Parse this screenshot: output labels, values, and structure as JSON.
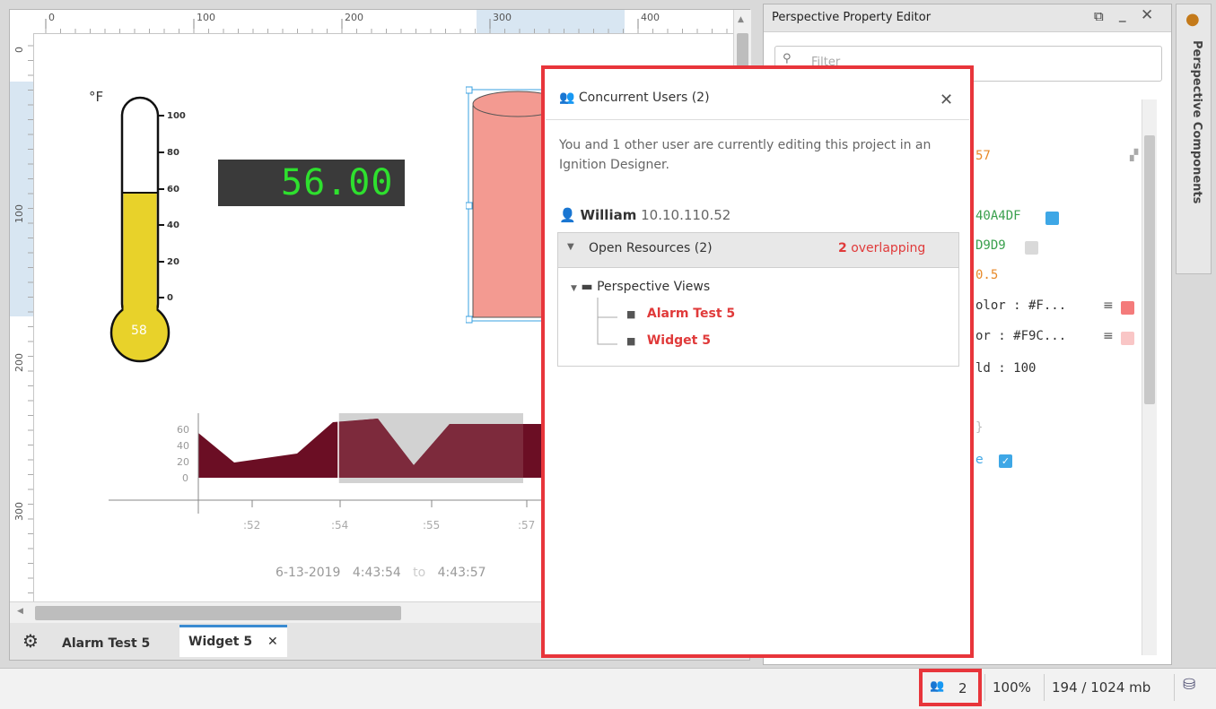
{
  "canvas": {
    "ruler_top_labels": [
      "0",
      "100",
      "200",
      "300",
      "400"
    ],
    "ruler_left_labels": [
      "0",
      "100",
      "200",
      "300"
    ],
    "thermometer": {
      "unit": "°F",
      "scale": [
        "100",
        "80",
        "60",
        "40",
        "20",
        "0"
      ],
      "value": "58",
      "fill_fraction": 0.58,
      "fill_color": "#e8d22a"
    },
    "led_display": {
      "value": "56.00",
      "color": "#2ee02e"
    },
    "tank": {
      "color": "#f39a91"
    },
    "sparkline": {
      "y_ticks": [
        "60",
        "40",
        "20",
        "0"
      ],
      "x_ticks": [
        ":52",
        ":54",
        ":55",
        ":57"
      ],
      "date": "6-13-2019",
      "start_time": "4:43:54",
      "to_label": "to",
      "end_time": "4:43:57",
      "fill_color": "#6b0e24"
    }
  },
  "tabs": {
    "settings_icon": "gear-icon",
    "items": [
      {
        "label": "Alarm Test 5",
        "active": false
      },
      {
        "label": "Widget 5",
        "active": true,
        "close": "✕"
      }
    ]
  },
  "property_editor": {
    "title": "Perspective Property Editor",
    "filter_placeholder": "Filter",
    "rows": [
      {
        "text": "57",
        "color": "#e88a2a"
      },
      {
        "text": "40A4DF",
        "color": "#3ea7e6"
      },
      {
        "text": "D9D9",
        "color": "#d9d9d9"
      },
      {
        "text": "0.5",
        "color": "#e88a2a"
      },
      {
        "text": "olor : #F...",
        "swatch": "#f47b7b"
      },
      {
        "text": "or : #F9C...",
        "swatch": "#f9c6c6"
      },
      {
        "text": "ld : 100"
      },
      {
        "text": "}"
      },
      {
        "text": "e",
        "checkbox": true
      }
    ]
  },
  "side_panel": {
    "label": "Perspective Components"
  },
  "popup": {
    "title": "Concurrent Users (2)",
    "close": "✕",
    "message": "You and 1 other user are currently editing this project in an Ignition Designer.",
    "user": {
      "name": "William",
      "ip": "10.10.110.52"
    },
    "resources": {
      "label": "Open Resources (2)",
      "overlap_count": "2",
      "overlap_label": "overlapping",
      "folder": "Perspective Views",
      "items": [
        "Alarm Test 5",
        "Widget 5"
      ]
    }
  },
  "status_bar": {
    "users_count": "2",
    "zoom": "100%",
    "memory": "194 / 1024 mb"
  }
}
